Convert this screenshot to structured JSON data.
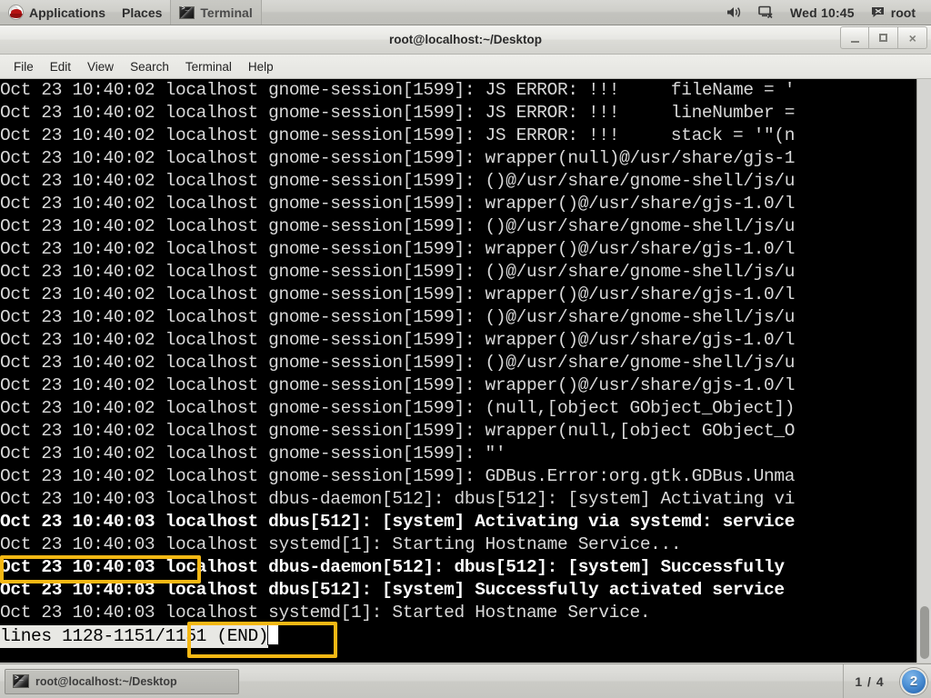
{
  "top_panel": {
    "logo_icon": "redhat-logo-icon",
    "menus": [
      {
        "label": "Applications",
        "name": "applications-menu"
      },
      {
        "label": "Places",
        "name": "places-menu"
      }
    ],
    "active_task": {
      "label": "Terminal",
      "icon": "terminal-icon"
    },
    "tray": {
      "volume_icon": "volume-icon",
      "network_icon": "network-disconnected-icon",
      "clock": "Wed 10:45",
      "message_icon": "message-icon",
      "user": "root"
    }
  },
  "window": {
    "title": "root@localhost:~/Desktop",
    "controls": {
      "minimize": "minimize-button",
      "maximize": "maximize-button",
      "close": "close-button"
    },
    "menubar": [
      "File",
      "Edit",
      "View",
      "Search",
      "Terminal",
      "Help"
    ]
  },
  "terminal": {
    "lines": [
      {
        "text": "Oct 23 10:40:02 localhost gnome-session[1599]: JS ERROR: !!!     fileName = '",
        "bold": false
      },
      {
        "text": "Oct 23 10:40:02 localhost gnome-session[1599]: JS ERROR: !!!     lineNumber =",
        "bold": false
      },
      {
        "text": "Oct 23 10:40:02 localhost gnome-session[1599]: JS ERROR: !!!     stack = '\"(n",
        "bold": false
      },
      {
        "text": "Oct 23 10:40:02 localhost gnome-session[1599]: wrapper(null)@/usr/share/gjs-1",
        "bold": false
      },
      {
        "text": "Oct 23 10:40:02 localhost gnome-session[1599]: ()@/usr/share/gnome-shell/js/u",
        "bold": false
      },
      {
        "text": "Oct 23 10:40:02 localhost gnome-session[1599]: wrapper()@/usr/share/gjs-1.0/l",
        "bold": false
      },
      {
        "text": "Oct 23 10:40:02 localhost gnome-session[1599]: ()@/usr/share/gnome-shell/js/u",
        "bold": false
      },
      {
        "text": "Oct 23 10:40:02 localhost gnome-session[1599]: wrapper()@/usr/share/gjs-1.0/l",
        "bold": false
      },
      {
        "text": "Oct 23 10:40:02 localhost gnome-session[1599]: ()@/usr/share/gnome-shell/js/u",
        "bold": false
      },
      {
        "text": "Oct 23 10:40:02 localhost gnome-session[1599]: wrapper()@/usr/share/gjs-1.0/l",
        "bold": false
      },
      {
        "text": "Oct 23 10:40:02 localhost gnome-session[1599]: ()@/usr/share/gnome-shell/js/u",
        "bold": false
      },
      {
        "text": "Oct 23 10:40:02 localhost gnome-session[1599]: wrapper()@/usr/share/gjs-1.0/l",
        "bold": false
      },
      {
        "text": "Oct 23 10:40:02 localhost gnome-session[1599]: ()@/usr/share/gnome-shell/js/u",
        "bold": false
      },
      {
        "text": "Oct 23 10:40:02 localhost gnome-session[1599]: wrapper()@/usr/share/gjs-1.0/l",
        "bold": false
      },
      {
        "text": "Oct 23 10:40:02 localhost gnome-session[1599]: (null,[object GObject_Object])",
        "bold": false
      },
      {
        "text": "Oct 23 10:40:02 localhost gnome-session[1599]: wrapper(null,[object GObject_O",
        "bold": false
      },
      {
        "text": "Oct 23 10:40:02 localhost gnome-session[1599]: \"'",
        "bold": false
      },
      {
        "text": "Oct 23 10:40:02 localhost gnome-session[1599]: GDBus.Error:org.gtk.GDBus.Unma",
        "bold": false
      },
      {
        "text": "Oct 23 10:40:03 localhost dbus-daemon[512]: dbus[512]: [system] Activating vi",
        "bold": false
      },
      {
        "text": "Oct 23 10:40:03 localhost dbus[512]: [system] Activating via systemd: service",
        "bold": true
      },
      {
        "text": "Oct 23 10:40:03 localhost systemd[1]: Starting Hostname Service...",
        "bold": false
      },
      {
        "text": "Oct 23 10:40:03 localhost dbus-daemon[512]: dbus[512]: [system] Successfully",
        "bold": true
      },
      {
        "text": "Oct 23 10:40:03 localhost dbus[512]: [system] Successfully activated service",
        "bold": true
      },
      {
        "text": "Oct 23 10:40:03 localhost systemd[1]: Started Hostname Service.",
        "bold": false
      }
    ],
    "status_line": "lines 1128-1151/1151 (END)",
    "scrollbar": "vertical-scrollbar"
  },
  "annotations": [
    {
      "name": "highlight-timestamp",
      "color": "#f5b814"
    },
    {
      "name": "highlight-status-line",
      "color": "#f5b814"
    }
  ],
  "taskbar": {
    "task": {
      "label": "root@localhost:~/Desktop",
      "icon": "terminal-icon"
    },
    "workspace": "1 / 4",
    "notification_count": "2"
  }
}
